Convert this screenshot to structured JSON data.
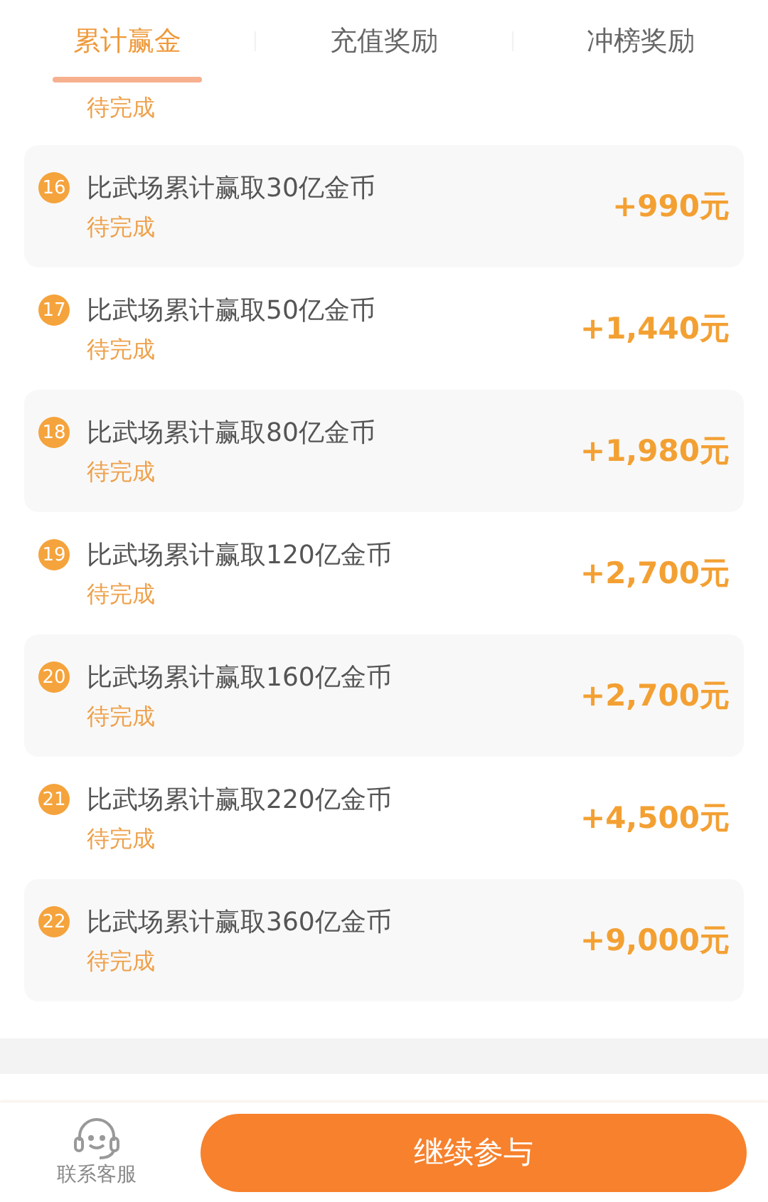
{
  "tabs": [
    {
      "label": "累计赢金",
      "selected": true
    },
    {
      "label": "充值奖励",
      "selected": false
    },
    {
      "label": "冲榜奖励",
      "selected": false
    }
  ],
  "partial_row": {
    "status": "待完成"
  },
  "tasks": [
    {
      "number": "16",
      "title": "比武场累计赢取30亿金币",
      "status": "待完成",
      "reward": "+990元"
    },
    {
      "number": "17",
      "title": "比武场累计赢取50亿金币",
      "status": "待完成",
      "reward": "+1,440元"
    },
    {
      "number": "18",
      "title": "比武场累计赢取80亿金币",
      "status": "待完成",
      "reward": "+1,980元"
    },
    {
      "number": "19",
      "title": "比武场累计赢取120亿金币",
      "status": "待完成",
      "reward": "+2,700元"
    },
    {
      "number": "20",
      "title": "比武场累计赢取160亿金币",
      "status": "待完成",
      "reward": "+2,700元"
    },
    {
      "number": "21",
      "title": "比武场累计赢取220亿金币",
      "status": "待完成",
      "reward": "+4,500元"
    },
    {
      "number": "22",
      "title": "比武场累计赢取360亿金币",
      "status": "待完成",
      "reward": "+9,000元"
    }
  ],
  "bottom_bar": {
    "support_label": "联系客服",
    "action_button": "继续参与"
  }
}
